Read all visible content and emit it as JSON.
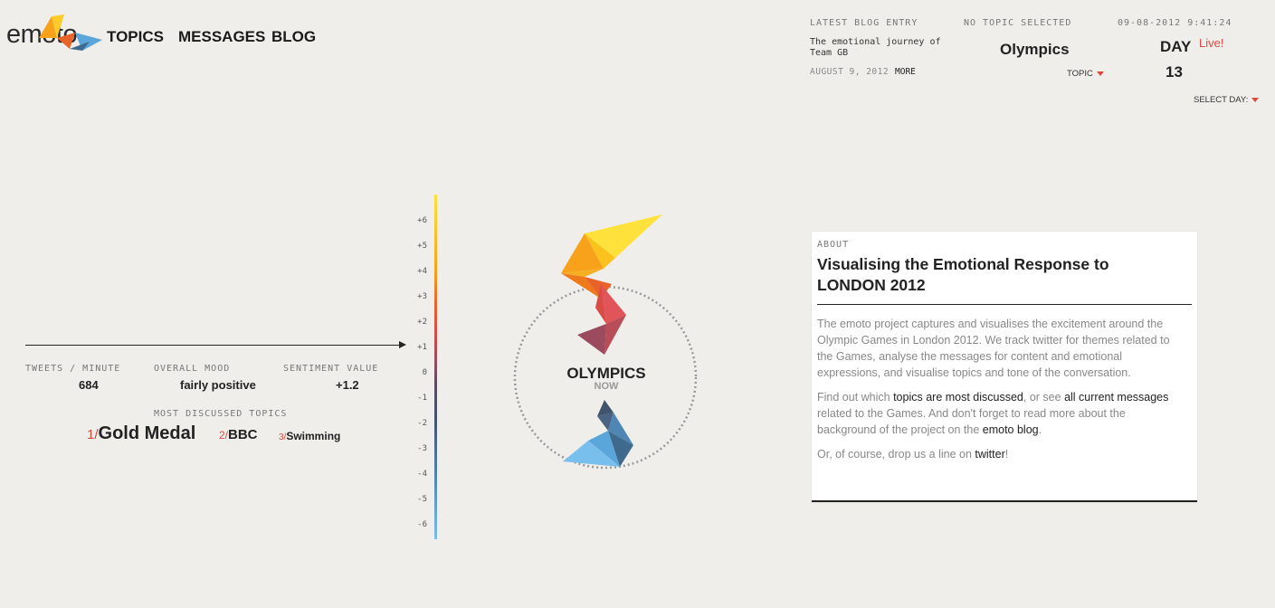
{
  "brand": {
    "logo_text": "emoto"
  },
  "nav": {
    "topics": "TOPICS",
    "messages": "MESSAGES",
    "blog": "BLOG"
  },
  "header": {
    "latest_blog_label": "LATEST BLOG ENTRY",
    "blog_title": "The emotional journey of Team GB",
    "blog_date": "AUGUST 9, 2012",
    "blog_more": "MORE",
    "topic_status": "NO TOPIC SELECTED",
    "topic_name": "Olympics",
    "topic_select": "TOPIC",
    "timestamp": "09-08-2012 9:41:24",
    "day_label": "DAY",
    "live": "Live!",
    "day_number": "13",
    "select_day": "SELECT DAY:"
  },
  "stats": {
    "tweets_label": "TWEETS / MINUTE",
    "tweets_value": "684",
    "mood_label": "OVERALL MOOD",
    "mood_value": "fairly positive",
    "sentiment_label": "SENTIMENT VALUE",
    "sentiment_value": "+1.2",
    "most_discussed_label": "MOST DISCUSSED TOPICS",
    "topics": [
      {
        "rank": "1/",
        "name": "Gold Medal"
      },
      {
        "rank": "2/",
        "name": "BBC"
      },
      {
        "rank": "3/",
        "name": "Swimming"
      }
    ]
  },
  "scale": {
    "ticks": [
      "+6",
      "+5",
      "+4",
      "+3",
      "+2",
      "+1",
      "0",
      "-1",
      "-2",
      "-3",
      "-4",
      "-5",
      "-6"
    ],
    "current_value": 1.2,
    "gradient": [
      "#ffe13b",
      "#f7a21a",
      "#e8622a",
      "#d94b45",
      "#9c4a5e",
      "#5b4b63",
      "#40546c",
      "#4f86b3",
      "#78bfee"
    ]
  },
  "center": {
    "title": "OLYMPICS",
    "subtitle": "NOW"
  },
  "about": {
    "label": "ABOUT",
    "title": "Visualising the Emotional Response to LONDON 2012",
    "p1": "The emoto project captures and visualises the excitement around the Olympic Games in London 2012.  We track twitter for themes related to the Games, analyse the messages for content and emotional expressions, and visualise topics and tone of the conversation.",
    "p2_a": "Find out which ",
    "p2_link1": "topics are most discussed",
    "p2_b": ", or see ",
    "p2_link2": "all current messages",
    "p2_c": " related to the Games. And don't forget to read more about the background of the project on the ",
    "p2_link3": "emoto blog",
    "p2_d": ".",
    "p3_a": "Or, of course, drop us a line on ",
    "p3_link": "twitter",
    "p3_b": "!"
  },
  "colors": {
    "accent": "#e0483e",
    "background": "#efeeeb"
  }
}
